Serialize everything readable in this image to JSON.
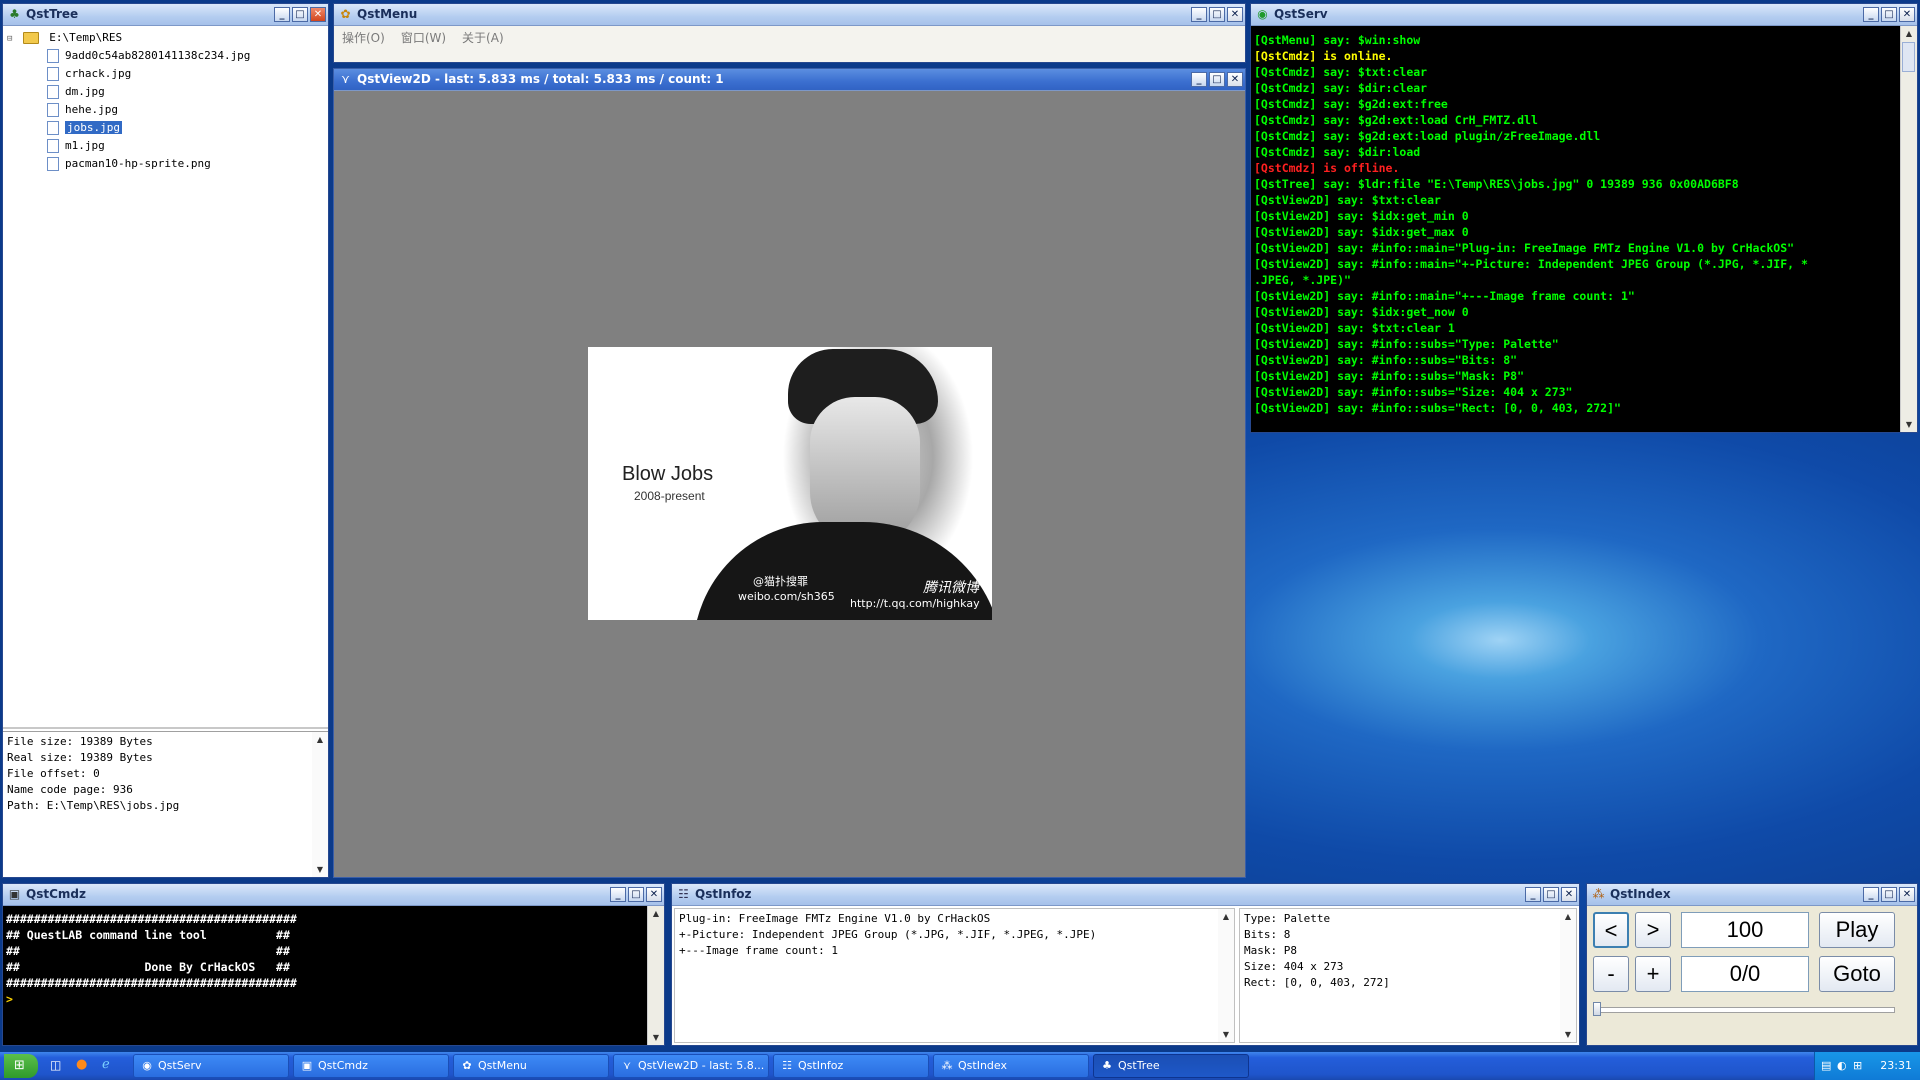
{
  "tree_window": {
    "title": "QstTree",
    "root": "E:\\Temp\\RES",
    "files": [
      "9add0c54ab8280141138c234.jpg",
      "crhack.jpg",
      "dm.jpg",
      "hehe.jpg",
      "jobs.jpg",
      "m1.jpg",
      "pacman10-hp-sprite.png"
    ],
    "selected_index": 4,
    "info_lines": [
      "File size: 19389 Bytes",
      "Real size: 19389 Bytes",
      "File offset: 0",
      "Name code page: 936",
      "Path: E:\\Temp\\RES\\jobs.jpg"
    ]
  },
  "menu_window": {
    "title": "QstMenu",
    "menu_items": [
      "操作(O)",
      "窗口(W)",
      "关于(A)"
    ]
  },
  "view_window": {
    "title": "QstView2D - last: 5.833 ms / total: 5.833 ms / count: 1",
    "image": {
      "headline": "Blow Jobs",
      "subline": "2008-present",
      "watermark_1": "@猫扑搜罪",
      "watermark_2": "weibo.com/sh365",
      "watermark_3": "腾讯微博",
      "watermark_4": "http://t.qq.com/highkay"
    }
  },
  "serv_window": {
    "title": "QstServ",
    "lines": [
      {
        "text": "[QstMenu] say: $win:show",
        "color": "#00ff00"
      },
      {
        "text": "[QstCmdz] is online.",
        "color": "#ffff00"
      },
      {
        "text": "[QstCmdz] say: $txt:clear",
        "color": "#00ff00"
      },
      {
        "text": "[QstCmdz] say: $dir:clear",
        "color": "#00ff00"
      },
      {
        "text": "[QstCmdz] say: $g2d:ext:free",
        "color": "#00ff00"
      },
      {
        "text": "[QstCmdz] say: $g2d:ext:load CrH_FMTZ.dll",
        "color": "#00ff00"
      },
      {
        "text": "[QstCmdz] say: $g2d:ext:load plugin/zFreeImage.dll",
        "color": "#00ff00"
      },
      {
        "text": "[QstCmdz] say: $dir:load",
        "color": "#00ff00"
      },
      {
        "text": "[QstCmdz] is offline.",
        "color": "#ff2020"
      },
      {
        "text": "[QstTree] say: $ldr:file \"E:\\Temp\\RES\\jobs.jpg\" 0 19389 936 0x00AD6BF8",
        "color": "#00ff00"
      },
      {
        "text": "[QstView2D] say: $txt:clear",
        "color": "#00ff00"
      },
      {
        "text": "[QstView2D] say: $idx:get_min 0",
        "color": "#00ff00"
      },
      {
        "text": "[QstView2D] say: $idx:get_max 0",
        "color": "#00ff00"
      },
      {
        "text": "[QstView2D] say: #info::main=\"Plug-in: FreeImage FMTz Engine V1.0 by CrHackOS\"",
        "color": "#00ff00"
      },
      {
        "text": "[QstView2D] say: #info::main=\"+-Picture: Independent JPEG Group (*.JPG, *.JIF, *",
        "color": "#00ff00"
      },
      {
        "text": ".JPEG, *.JPE)\"",
        "color": "#00ff00"
      },
      {
        "text": "[QstView2D] say: #info::main=\"+---Image frame count: 1\"",
        "color": "#00ff00"
      },
      {
        "text": "[QstView2D] say: $idx:get_now 0",
        "color": "#00ff00"
      },
      {
        "text": "[QstView2D] say: $txt:clear 1",
        "color": "#00ff00"
      },
      {
        "text": "[QstView2D] say: #info::subs=\"Type: Palette\"",
        "color": "#00ff00"
      },
      {
        "text": "[QstView2D] say: #info::subs=\"Bits: 8\"",
        "color": "#00ff00"
      },
      {
        "text": "[QstView2D] say: #info::subs=\"Mask: P8\"",
        "color": "#00ff00"
      },
      {
        "text": "[QstView2D] say: #info::subs=\"Size: 404 x 273\"",
        "color": "#00ff00"
      },
      {
        "text": "[QstView2D] say: #info::subs=\"Rect: [0, 0, 403, 272]\"",
        "color": "#00ff00"
      }
    ]
  },
  "cmdz_window": {
    "title": "QstCmdz",
    "lines": [
      "##########################################",
      "## QuestLAB command line tool          ##",
      "##                                     ##",
      "##                  Done By CrHackOS   ##",
      "##########################################"
    ],
    "prompt": ">"
  },
  "infoz_window": {
    "title": "QstInfoz",
    "left_lines": [
      "Plug-in: FreeImage FMTz Engine V1.0 by CrHackOS",
      "+-Picture: Independent JPEG Group (*.JPG, *.JIF, *.JPEG, *.JPE)",
      "+---Image frame count: 1"
    ],
    "right_lines": [
      "Type: Palette",
      "Bits: 8",
      "Mask: P8",
      "Size: 404 x 273",
      "Rect: [0, 0, 403, 272]"
    ]
  },
  "index_window": {
    "title": "QstIndex",
    "prev_label": "<",
    "next_label": ">",
    "minus_label": "-",
    "plus_label": "+",
    "delay_value": "100",
    "index_value": "0/0",
    "play_label": "Play",
    "goto_label": "Goto",
    "slider_fraction": 0
  },
  "taskbar": {
    "items": [
      "QstServ",
      "QstCmdz",
      "QstMenu",
      "QstView2D - last: 5.8...",
      "QstInfoz",
      "QstIndex",
      "QstTree"
    ],
    "active_index": 6,
    "clock": "23:31"
  }
}
